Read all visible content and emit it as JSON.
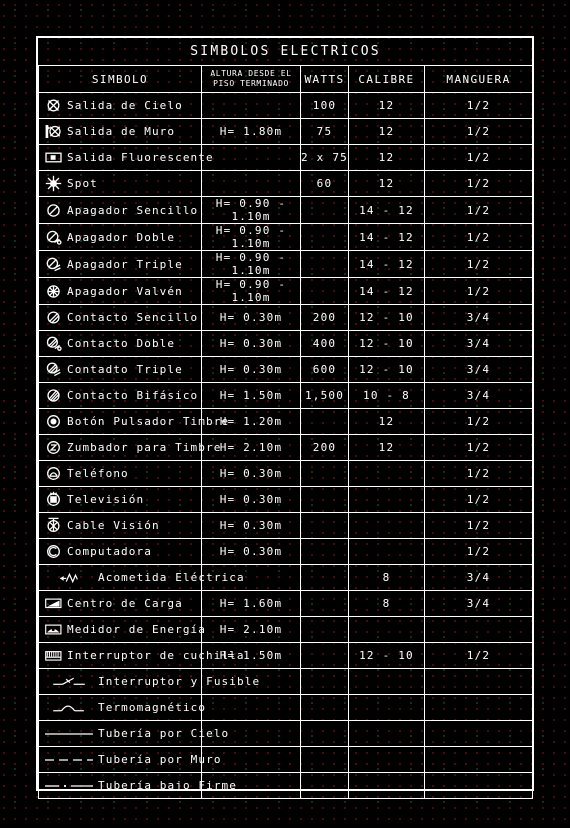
{
  "title": "SIMBOLOS ELECTRICOS",
  "columns": {
    "simbolo": "SIMBOLO",
    "altura_l1": "ALTURA DESDE EL",
    "altura_l2": "PISO TERMINADO",
    "watts": "WATTS",
    "calibre": "CALIBRE",
    "manguera": "MANGUERA"
  },
  "colors": {
    "ink": "#ffffff",
    "background": "#000000",
    "grid_red": "#4a0f12",
    "grid_green": "#0d3a14"
  },
  "rows": [
    {
      "icon": "ceiling-outlet-icon",
      "label": "Salida de Cielo",
      "altura": "",
      "watts": "100",
      "calibre": "12",
      "manguera": "1/2"
    },
    {
      "icon": "wall-outlet-icon",
      "label": "Salida de Muro",
      "altura": "H= 1.80m",
      "watts": "75",
      "calibre": "12",
      "manguera": "1/2"
    },
    {
      "icon": "fluorescent-outlet-icon",
      "label": "Salida Fluorescente",
      "altura": "",
      "watts": "2 x 75",
      "calibre": "12",
      "manguera": "1/2"
    },
    {
      "icon": "spot-icon",
      "label": "Spot",
      "altura": "",
      "watts": "60",
      "calibre": "12",
      "manguera": "1/2"
    },
    {
      "icon": "switch-single-icon",
      "label": "Apagador Sencillo",
      "altura": "H= 0.90 - 1.10m",
      "watts": "",
      "calibre": "14 - 12",
      "manguera": "1/2"
    },
    {
      "icon": "switch-double-icon",
      "label": "Apagador Doble",
      "altura": "H= 0.90 - 1.10m",
      "watts": "",
      "calibre": "14 - 12",
      "manguera": "1/2"
    },
    {
      "icon": "switch-triple-icon",
      "label": "Apagador Triple",
      "altura": "H= 0.90 - 1.10m",
      "watts": "",
      "calibre": "14 - 12",
      "manguera": "1/2"
    },
    {
      "icon": "switch-three-way-icon",
      "label": "Apagador Valvén",
      "altura": "H= 0.90 - 1.10m",
      "watts": "",
      "calibre": "14 - 12",
      "manguera": "1/2"
    },
    {
      "icon": "contact-single-icon",
      "label": "Contacto Sencillo",
      "altura": "H= 0.30m",
      "watts": "200",
      "calibre": "12 - 10",
      "manguera": "3/4"
    },
    {
      "icon": "contact-double-icon",
      "label": "Contacto Doble",
      "altura": "H= 0.30m",
      "watts": "400",
      "calibre": "12 - 10",
      "manguera": "3/4"
    },
    {
      "icon": "contact-triple-icon",
      "label": "Contadto Triple",
      "altura": "H= 0.30m",
      "watts": "600",
      "calibre": "12 - 10",
      "manguera": "3/4"
    },
    {
      "icon": "contact-biphasic-icon",
      "label": "Contacto Bifásico",
      "altura": "H= 1.50m",
      "watts": "1,500",
      "calibre": "10 - 8",
      "manguera": "3/4"
    },
    {
      "icon": "push-button-icon",
      "label": "Botón Pulsador Timbre",
      "altura": "H= 1.20m",
      "watts": "",
      "calibre": "12",
      "manguera": "1/2"
    },
    {
      "icon": "buzzer-icon",
      "label": "Zumbador para Timbre",
      "altura": "H= 2.10m",
      "watts": "200",
      "calibre": "12",
      "manguera": "1/2"
    },
    {
      "icon": "telephone-icon",
      "label": "Teléfono",
      "altura": "H= 0.30m",
      "watts": "",
      "calibre": "",
      "manguera": "1/2"
    },
    {
      "icon": "television-icon",
      "label": "Televisión",
      "altura": "H= 0.30m",
      "watts": "",
      "calibre": "",
      "manguera": "1/2"
    },
    {
      "icon": "cable-vision-icon",
      "label": "Cable Visión",
      "altura": "H= 0.30m",
      "watts": "",
      "calibre": "",
      "manguera": "1/2"
    },
    {
      "icon": "computer-icon",
      "label": "Computadora",
      "altura": "H= 0.30m",
      "watts": "",
      "calibre": "",
      "manguera": "1/2"
    },
    {
      "icon": "service-entrance-icon",
      "label": "Acometida Eléctrica",
      "altura": "",
      "watts": "",
      "calibre": "8",
      "manguera": "3/4"
    },
    {
      "icon": "load-center-icon",
      "label": "Centro de Carga",
      "altura": "H= 1.60m",
      "watts": "",
      "calibre": "8",
      "manguera": "3/4"
    },
    {
      "icon": "energy-meter-icon",
      "label": "Medidor de Energía",
      "altura": "H= 2.10m",
      "watts": "",
      "calibre": "",
      "manguera": ""
    },
    {
      "icon": "knife-switch-icon",
      "label": "Interruptor de cuchilla",
      "altura": "H= 1.50m",
      "watts": "",
      "calibre": "12 - 10",
      "manguera": "1/2"
    },
    {
      "icon": "switch-fuse-icon",
      "label": "Interruptor y Fusible",
      "altura": "",
      "watts": "",
      "calibre": "",
      "manguera": ""
    },
    {
      "icon": "thermomagnetic-icon",
      "label": "Termomagnético",
      "altura": "",
      "watts": "",
      "calibre": "",
      "manguera": ""
    },
    {
      "icon": "pipe-ceiling-icon",
      "label": "Tubería por Cielo",
      "altura": "",
      "watts": "",
      "calibre": "",
      "manguera": ""
    },
    {
      "icon": "pipe-wall-icon",
      "label": "Tubería por Muro",
      "altura": "",
      "watts": "",
      "calibre": "",
      "manguera": ""
    },
    {
      "icon": "pipe-underfloor-icon",
      "label": "Tubería bajo Firme",
      "altura": "",
      "watts": "",
      "calibre": "",
      "manguera": ""
    }
  ]
}
